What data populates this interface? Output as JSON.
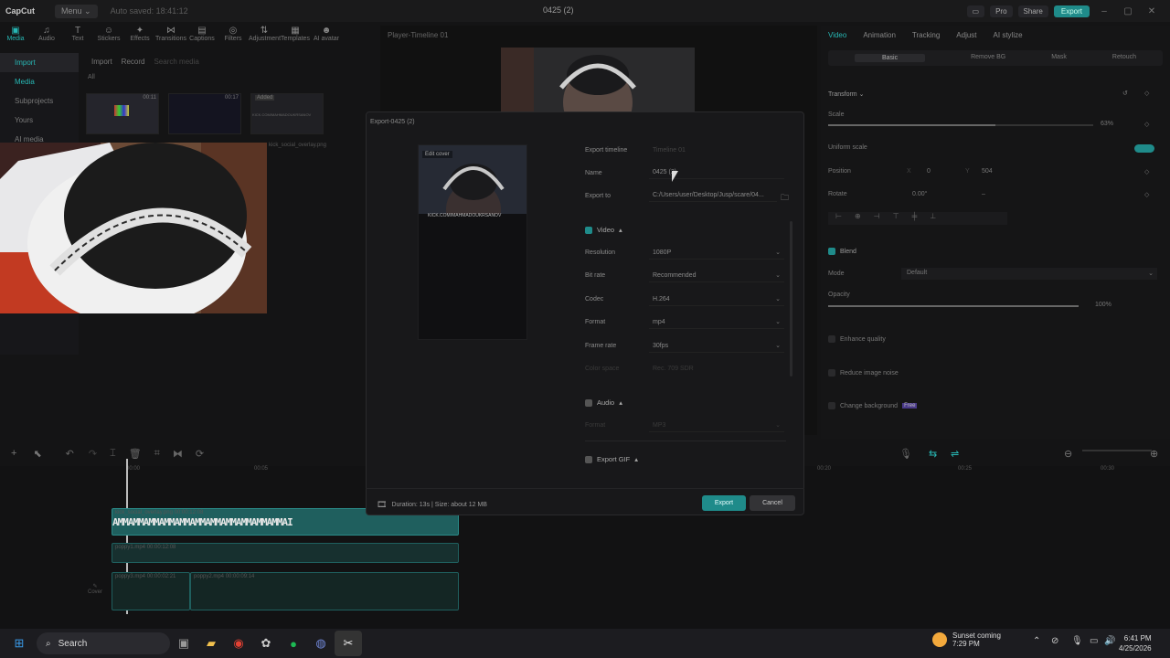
{
  "titlebar": {
    "logo": "CapCut",
    "menu": "Menu ⌄",
    "autosave": "Auto saved: 18:41:12",
    "title": "0425 (2)",
    "pro": "Pro",
    "share": "Share",
    "export": "Export"
  },
  "toolbar": [
    {
      "label": "Media",
      "icon": "media-icon",
      "glyph": "▣"
    },
    {
      "label": "Audio",
      "icon": "audio-icon",
      "glyph": "♫"
    },
    {
      "label": "Text",
      "icon": "text-icon",
      "glyph": "T"
    },
    {
      "label": "Stickers",
      "icon": "stickers-icon",
      "glyph": "☺"
    },
    {
      "label": "Effects",
      "icon": "effects-icon",
      "glyph": "✦"
    },
    {
      "label": "Transitions",
      "icon": "transitions-icon",
      "glyph": "⋈"
    },
    {
      "label": "Captions",
      "icon": "captions-icon",
      "glyph": "▤"
    },
    {
      "label": "Filters",
      "icon": "filters-icon",
      "glyph": "◎"
    },
    {
      "label": "Adjustment",
      "icon": "adjustment-icon",
      "glyph": "⇅"
    },
    {
      "label": "Templates",
      "icon": "templates-icon",
      "glyph": "▦"
    },
    {
      "label": "AI avatar",
      "icon": "ai-avatar-icon",
      "glyph": "☻"
    }
  ],
  "sidebar": {
    "import": "Import",
    "media": "Media",
    "subprojects": "Subprojects",
    "yours": "Yours",
    "ai_media": "AI media"
  },
  "media_panel": {
    "import": "Import",
    "record": "Record",
    "search_placeholder": "Search media",
    "all": "All",
    "thumb_durations": [
      "00:11",
      "00:17"
    ],
    "added": "Added",
    "file_name": "kick_social_overlay.png",
    "kick_url": "KICK.COM/MAHMADOUKRSANOV"
  },
  "player": {
    "title": "Player-Timeline 01"
  },
  "right_panel": {
    "tabs": [
      "Video",
      "Animation",
      "Tracking",
      "Adjust",
      "AI stylize"
    ],
    "subtabs": [
      "Basic",
      "Remove BG",
      "Mask",
      "Retouch"
    ],
    "transform": "Transform",
    "scale": "Scale",
    "scale_value": "63%",
    "scale_level": 0.63,
    "uniform_scale": "Uniform scale",
    "position": "Position",
    "pos_x_label": "X",
    "pos_x": "0",
    "pos_y_label": "Y",
    "pos_y": "504",
    "rotate": "Rotate",
    "rotate_value": "0.00°",
    "rotate_dash": "–",
    "blend": "Blend",
    "mode": "Mode",
    "mode_value": "Default",
    "opacity": "Opacity",
    "opacity_value": "100%",
    "opacity_level": 1.0,
    "enhance_quality": "Enhance quality",
    "reduce_noise": "Reduce image noise",
    "change_background": "Change background",
    "free_badge": "Free"
  },
  "export_dialog": {
    "title": "Export-0425 (2)",
    "edit_cover": "Edit cover",
    "cover_kick_text": "KICK.COM/MAHMADOUKRSANOV",
    "export_timeline_label": "Export timeline",
    "export_timeline_value": "Timeline 01",
    "name_label": "Name",
    "name_value": "0425 (2)",
    "export_to_label": "Export to",
    "export_to_value": "C:/Users/user/Desktop/Jusp/scare/04...",
    "video_section": "Video",
    "resolution_label": "Resolution",
    "resolution_value": "1080P",
    "bitrate_label": "Bit rate",
    "bitrate_value": "Recommended",
    "codec_label": "Codec",
    "codec_value": "H.264",
    "format_label": "Format",
    "format_value": "mp4",
    "framerate_label": "Frame rate",
    "framerate_value": "30fps",
    "color_space_label": "Color space",
    "color_space_value": "Rec. 709 SDR",
    "audio_section": "Audio",
    "audio_format_label": "Format",
    "audio_format_value": "MP3",
    "gif_section": "Export GIF",
    "footer_info": "Duration: 13s | Size: about 12 MB",
    "export_button": "Export",
    "cancel_button": "Cancel"
  },
  "timeline": {
    "clip1_label": "kick_social_overlay.png  00:00:12:08",
    "clip1_text": "AMMAMMAMMAMMAMMAMMAMMAMMAMMAMMAMMAI",
    "clip2_label": "poppy1.mp4  00:00:12:08",
    "clip3_label": "poppy3.mp4  00:00:02:21",
    "clip3b_label": "poppy2.mp4  00:00:09:14",
    "cover_label": "Cover",
    "time_start": "00:00",
    "time_mid": "00:05",
    "time_r1": "00:20",
    "time_r2": "00:25",
    "time_r3": "00:30"
  },
  "taskbar": {
    "search": "Search",
    "weather_title": "Sunset coming",
    "weather_sub": "7:29 PM",
    "time": "6:41 PM",
    "date": "4/25/2026"
  },
  "colors": {
    "accent": "#1f8b8a",
    "accent_text": "#27b7b4",
    "background": "#141415"
  }
}
